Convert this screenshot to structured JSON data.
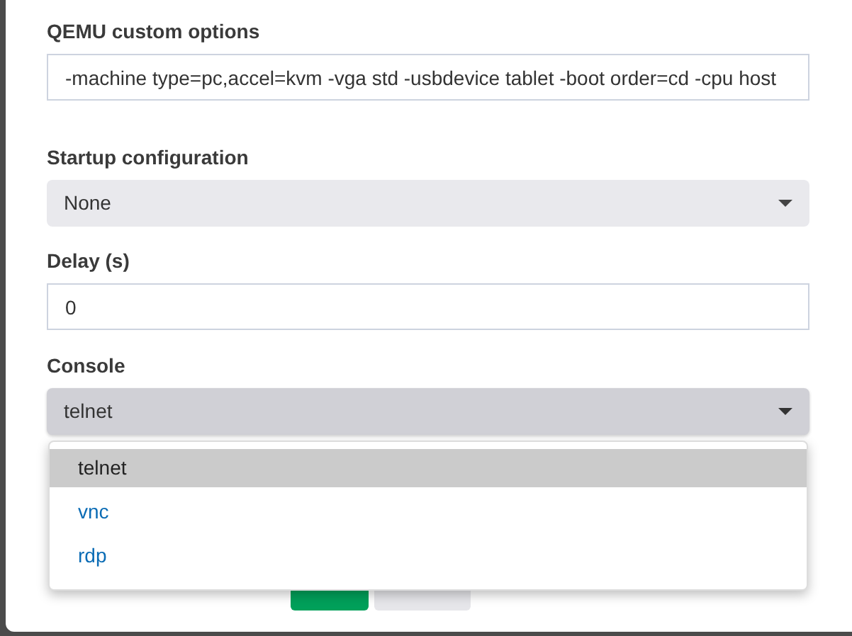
{
  "fields": [
    {
      "kind": "text",
      "label": "QEMU custom options",
      "value": "-machine type=pc,accel=kvm -vga std -usbdevice tablet -boot order=cd -cpu host"
    },
    {
      "kind": "select",
      "label": "Startup configuration",
      "value": "None",
      "open": false
    },
    {
      "kind": "text",
      "label": "Delay (s)",
      "value": "0"
    },
    {
      "kind": "select",
      "label": "Console",
      "value": "telnet",
      "open": true
    }
  ],
  "console_menu": [
    {
      "label": "telnet",
      "selected": true
    },
    {
      "label": "vnc",
      "selected": false
    },
    {
      "label": "rdp",
      "selected": false
    }
  ],
  "buttons": [
    {
      "kind": "primary"
    },
    {
      "kind": "secondary"
    }
  ]
}
